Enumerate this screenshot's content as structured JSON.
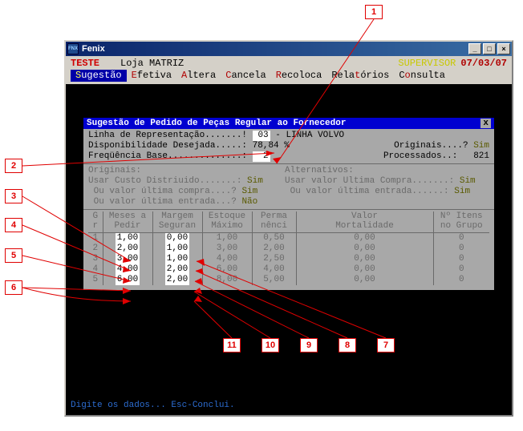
{
  "window": {
    "title": "Fenix"
  },
  "menubar": {
    "teste": "TESTE",
    "loja": "Loja MATRIZ",
    "supervisor": "SUPERVISOR",
    "date": "07/03/07",
    "items": {
      "sugestao": "Sugestão",
      "efetiva": "Efetiva",
      "altera": "Altera",
      "cancela": "Cancela",
      "recoloca": "Recoloca",
      "relatorios": "Relatórios",
      "consulta": "Consulta"
    }
  },
  "panel": {
    "title": "Sugestão de Pedido de Peças Regular ao Fornecedor",
    "linha_label": "Linha de Representação.......!",
    "linha_code": "03",
    "linha_desc": "- LINHA VOLVO",
    "disp_label": "Disponibilidade Desejada.....:",
    "disp_value": "78,84 %",
    "freq_label": "Freqüência Base..............:",
    "freq_value": "2",
    "originais_q": "Originais....?",
    "originais_v": "Sim",
    "processados_l": "Processados..:",
    "processados_v": "821",
    "sec_originais": "Originais:",
    "sec_alternativos": "Alternativos:",
    "usar_custo": "Usar Custo Distriuido.......:",
    "usar_custo_v": "Sim",
    "ou_valor_compra": "Ou valor última compra....?",
    "ou_valor_compra_v": "Sim",
    "ou_valor_entrada": "Ou valor última entrada...?",
    "ou_valor_entrada_v": "Não",
    "alt_usar_valor": "Usar valor Ultima Compra.......:",
    "alt_usar_valor_v": "Sim",
    "alt_ou_entrada": "Ou valor última entrada......:",
    "alt_ou_entrada_v": "Sim"
  },
  "table": {
    "headers": {
      "gr": "G\nr",
      "meses": "Meses a\nPedir",
      "margem": "Margem\nSeguran",
      "estoque": "Estoque\nMáximo",
      "perma": "Perma\nnênci",
      "valor": "Valor\nMortalidade",
      "itens": "Nº Itens\nno Grupo"
    },
    "rows": [
      {
        "g": "1",
        "meses": "1,00",
        "margem": "0,00",
        "estoque": "1,00",
        "perma": "0,50",
        "valor": "0,00",
        "itens": "0"
      },
      {
        "g": "2",
        "meses": "2,00",
        "margem": "1,00",
        "estoque": "3,00",
        "perma": "2,00",
        "valor": "0,00",
        "itens": "0"
      },
      {
        "g": "3",
        "meses": "3,00",
        "margem": "1,00",
        "estoque": "4,00",
        "perma": "2,50",
        "valor": "0,00",
        "itens": "0"
      },
      {
        "g": "4",
        "meses": "4,00",
        "margem": "2,00",
        "estoque": "6,00",
        "perma": "4,00",
        "valor": "0,00",
        "itens": "0"
      },
      {
        "g": "5",
        "meses": "6,00",
        "margem": "2,00",
        "estoque": "8,00",
        "perma": "5,00",
        "valor": "0,00",
        "itens": "0"
      }
    ]
  },
  "status": "Digite os dados...  Esc-Conclui.",
  "callouts": [
    "1",
    "2",
    "3",
    "4",
    "5",
    "6",
    "7",
    "8",
    "9",
    "10",
    "11"
  ]
}
